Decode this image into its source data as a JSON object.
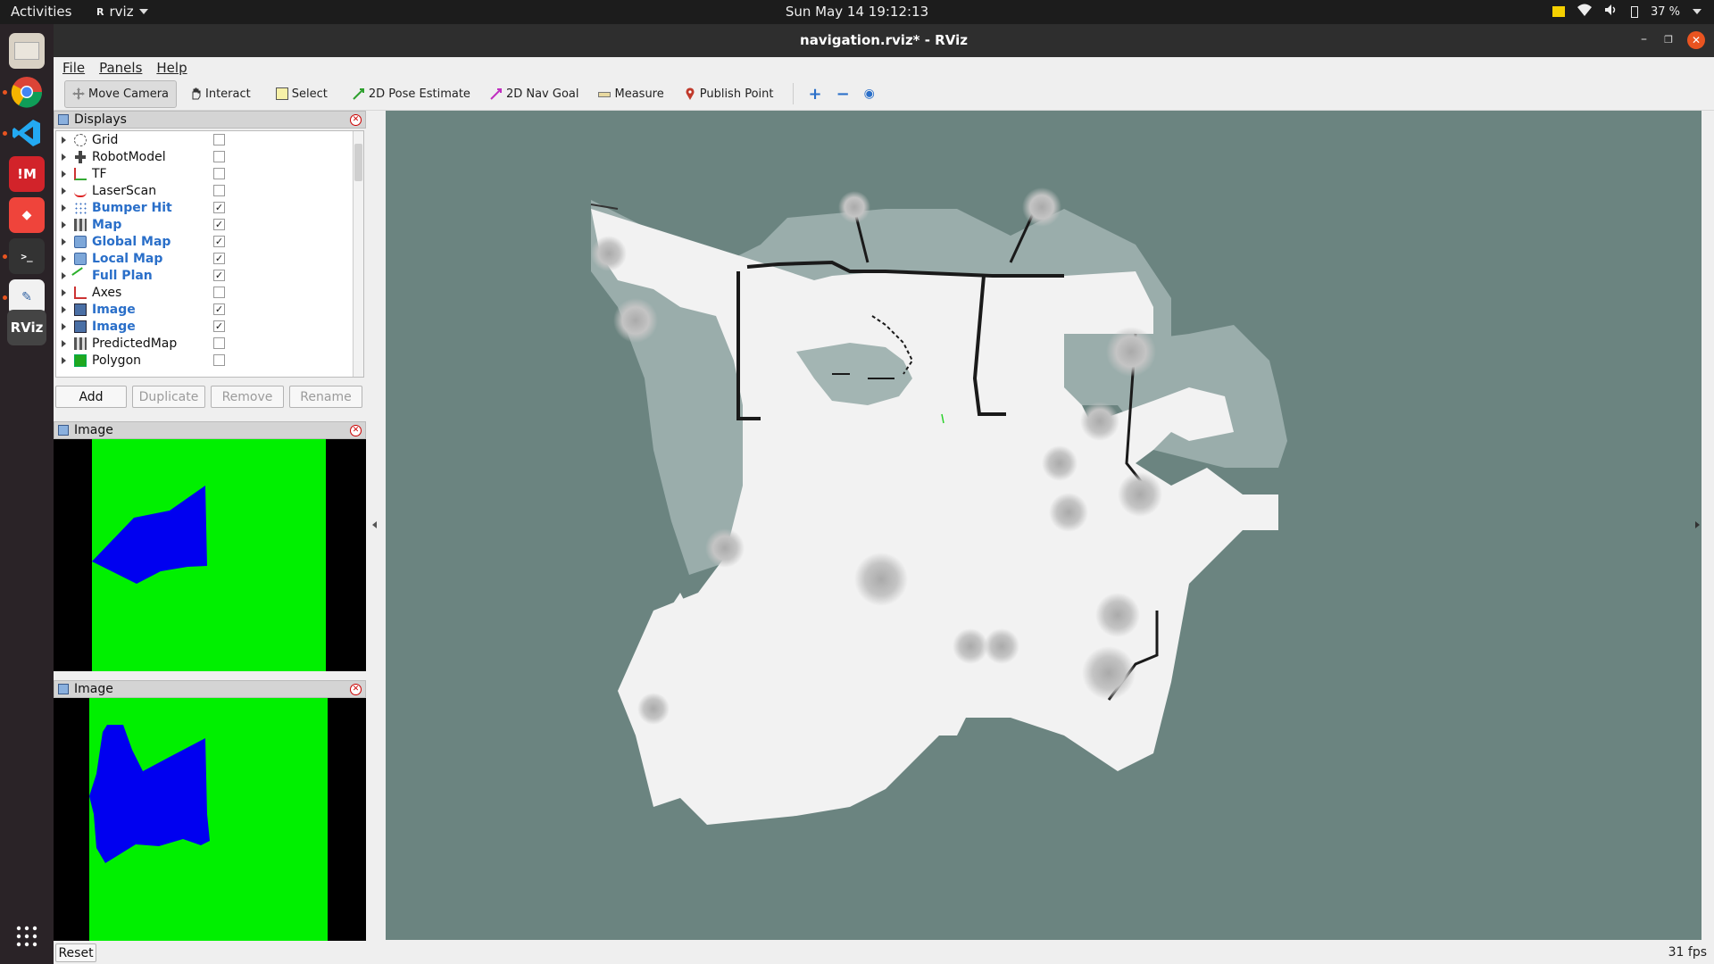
{
  "topbar": {
    "activities": "Activities",
    "app_name": "rviz",
    "clock": "Sun May 14  19:12:13",
    "battery": "37 %"
  },
  "window": {
    "title": "navigation.rviz* - RViz",
    "menu": [
      "File",
      "Panels",
      "Help"
    ]
  },
  "toolbar": {
    "tools": [
      {
        "label": "Move Camera",
        "icon": "move-camera-icon"
      },
      {
        "label": "Interact",
        "icon": "hand-icon"
      },
      {
        "label": "Select",
        "icon": "select-icon"
      },
      {
        "label": "2D Pose Estimate",
        "icon": "pose-arrow-icon"
      },
      {
        "label": "2D Nav Goal",
        "icon": "nav-goal-arrow-icon"
      },
      {
        "label": "Measure",
        "icon": "ruler-icon"
      },
      {
        "label": "Publish Point",
        "icon": "map-pin-icon"
      }
    ]
  },
  "displays": {
    "title": "Displays",
    "items": [
      {
        "name": "Grid",
        "checked": false,
        "icon": "grid-icon"
      },
      {
        "name": "RobotModel",
        "checked": false,
        "icon": "robot-icon"
      },
      {
        "name": "TF",
        "checked": false,
        "icon": "tf-icon"
      },
      {
        "name": "LaserScan",
        "checked": false,
        "icon": "laser-icon"
      },
      {
        "name": "Bumper Hit",
        "checked": true,
        "icon": "points-icon"
      },
      {
        "name": "Map",
        "checked": true,
        "icon": "map-icon"
      },
      {
        "name": "Global Map",
        "checked": true,
        "icon": "folder-icon"
      },
      {
        "name": "Local Map",
        "checked": true,
        "icon": "folder-icon"
      },
      {
        "name": "Full Plan",
        "checked": true,
        "icon": "path-icon"
      },
      {
        "name": "Axes",
        "checked": false,
        "icon": "axes-icon"
      },
      {
        "name": "Image",
        "checked": true,
        "icon": "image-icon"
      },
      {
        "name": "Image",
        "checked": true,
        "icon": "image-icon"
      },
      {
        "name": "PredictedMap",
        "checked": false,
        "icon": "map-icon"
      },
      {
        "name": "Polygon",
        "checked": false,
        "icon": "polygon-icon"
      }
    ],
    "buttons": [
      "Add",
      "Duplicate",
      "Remove",
      "Rename"
    ]
  },
  "image_panels": [
    {
      "title": "Image"
    },
    {
      "title": "Image"
    }
  ],
  "bottom": {
    "reset_label": "Reset",
    "fps": "31 fps"
  },
  "colors": {
    "map_unknown": "#6b8480",
    "map_free": "#f2f2f2",
    "map_costmap": "#9aadab",
    "obstacle": "#1a1a1a",
    "image_green": "#00f000",
    "image_blue": "#0000f0",
    "selected_display": "#2a6fc9"
  }
}
